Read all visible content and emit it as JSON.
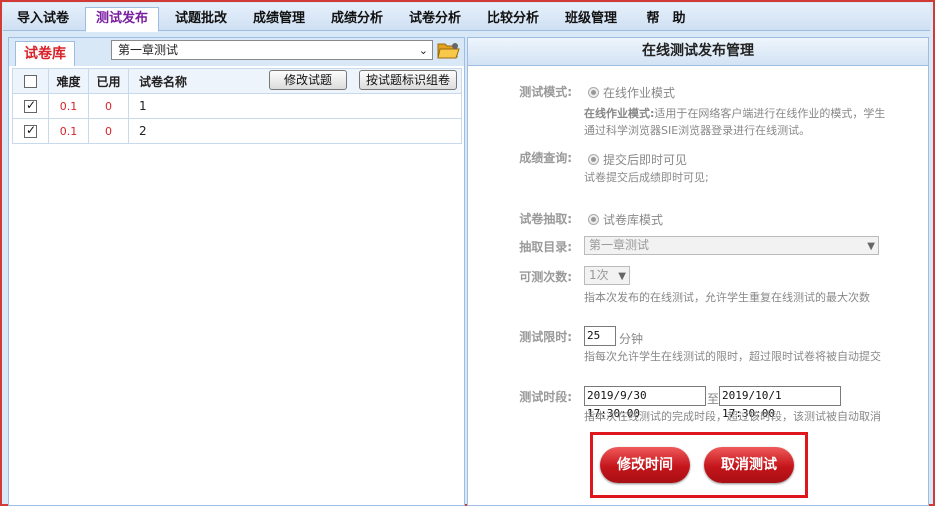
{
  "tabs": [
    {
      "label": "导入试卷"
    },
    {
      "label": "测试发布"
    },
    {
      "label": "试题批改"
    },
    {
      "label": "成绩管理"
    },
    {
      "label": "成绩分析"
    },
    {
      "label": "试卷分析"
    },
    {
      "label": "比较分析"
    },
    {
      "label": "班级管理"
    },
    {
      "label": "帮　助"
    }
  ],
  "library": {
    "tab_label": "试卷库",
    "chapter_select": "第一章测试",
    "edit_button": "修改试题",
    "group_button": "按试题标识组卷",
    "columns": [
      "难度",
      "已用",
      "试卷名称"
    ],
    "rows": [
      {
        "checked": true,
        "difficulty": "0.1",
        "used": "0",
        "name": "1"
      },
      {
        "checked": true,
        "difficulty": "0.1",
        "used": "0",
        "name": "2"
      }
    ]
  },
  "publish": {
    "title": "在线测试发布管理",
    "mode_label": "测试模式:",
    "mode_value": "在线作业模式",
    "mode_desc_bold": "在线作业模式:",
    "mode_desc_1": "适用于在网络客户端进行在线作业的模式，学生",
    "mode_desc_2": "通过科学浏览器SIE浏览器登录进行在线测试。",
    "score_label": "成绩查询:",
    "score_value": "提交后即时可见",
    "score_desc": "试卷提交后成绩即时可见;",
    "extract_label": "试卷抽取:",
    "extract_value": "试卷库模式",
    "dir_label": "抽取目录:",
    "dir_value": "第一章测试",
    "times_label": "可测次数:",
    "times_value": "1次",
    "times_desc": "指本次发布的在线测试，允许学生重复在线测试的最大次数",
    "limit_label": "测试限时:",
    "limit_value": "25",
    "limit_unit": "分钟",
    "limit_desc": "指每次允许学生在线测试的限时，超过限时试卷将被自动提交",
    "period_label": "测试时段:",
    "period_start": "2019/9/30 17:30:00",
    "period_to": "至",
    "period_end": "2019/10/1 17:30:00",
    "period_desc": "指本次在线测试的完成时段，超过该时段，该测试被自动取消",
    "modify_time_button": "修改时间",
    "cancel_test_button": "取消测试"
  }
}
